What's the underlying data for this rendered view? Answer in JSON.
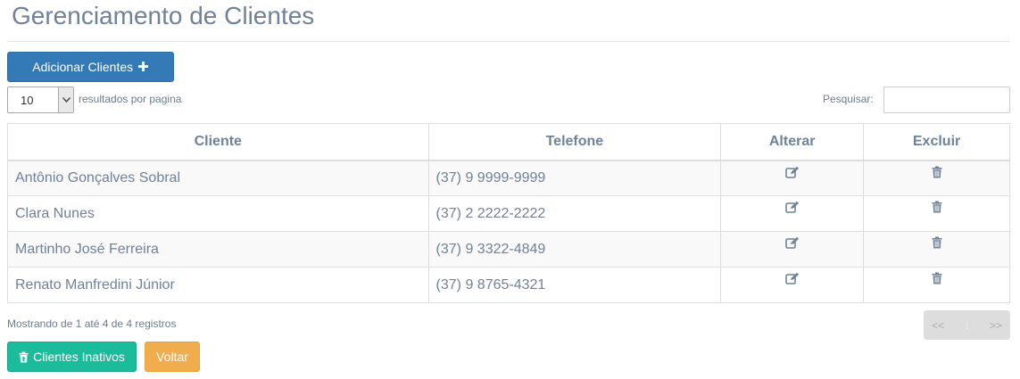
{
  "page": {
    "title": "Gerenciamento de Clientes"
  },
  "toolbar": {
    "add_label": "Adicionar Clientes",
    "add_icon": "plus-icon"
  },
  "length": {
    "value": "10",
    "label": "resultados por pagina"
  },
  "search": {
    "label": "Pesquisar:",
    "value": "",
    "placeholder": ""
  },
  "table": {
    "headers": [
      "Cliente",
      "Telefone",
      "Alterar",
      "Excluir"
    ],
    "rows": [
      {
        "cliente": "Antônio Gonçalves Sobral",
        "telefone": "(37) 9 9999-9999",
        "edit_icon": "edit-icon",
        "delete_icon": "trash-icon"
      },
      {
        "cliente": "Clara Nunes",
        "telefone": "(37) 2 2222-2222",
        "edit_icon": "edit-icon",
        "delete_icon": "trash-icon"
      },
      {
        "cliente": "Martinho José Ferreira",
        "telefone": "(37) 9 3322-4849",
        "edit_icon": "edit-icon",
        "delete_icon": "trash-icon"
      },
      {
        "cliente": "Renato Manfredini Júnior",
        "telefone": "(37) 9 8765-4321",
        "edit_icon": "edit-icon",
        "delete_icon": "trash-icon"
      }
    ]
  },
  "footer": {
    "info": "Mostrando de 1 até 4 de 4 registros",
    "pager": {
      "prev": "<<",
      "page": "1",
      "next": ">>"
    }
  },
  "actions": {
    "inativos_label": "Clientes Inativos",
    "inativos_icon": "trash-icon",
    "voltar_label": "Voltar"
  },
  "colors": {
    "primary": "#337ab7",
    "success": "#1abc9c",
    "warning": "#f0ad4e"
  }
}
